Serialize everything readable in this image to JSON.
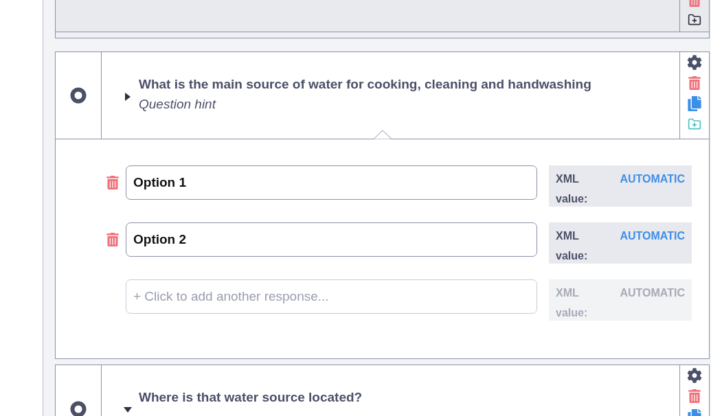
{
  "previous_question": {
    "actions": [
      {
        "kind": "delete"
      },
      {
        "kind": "add_to_group"
      }
    ]
  },
  "questions": [
    {
      "label": "What is the main source of water for cooking, cleaning and handwashing",
      "hint": "Question hint",
      "expanded": false,
      "actions": [
        {
          "kind": "settings"
        },
        {
          "kind": "delete"
        },
        {
          "kind": "duplicate"
        },
        {
          "kind": "add_group"
        }
      ],
      "options": [
        {
          "kind": "option",
          "value": "Option 1",
          "xml_label": "XML value:",
          "xml_value": "AUTOMATIC"
        },
        {
          "kind": "option",
          "value": "Option 2",
          "xml_label": "XML value:",
          "xml_value": "AUTOMATIC"
        },
        {
          "kind": "add",
          "placeholder": "+ Click to add another response...",
          "xml_label": "XML value:",
          "xml_value": "AUTOMATIC"
        }
      ]
    },
    {
      "label": "Where is that water source located?",
      "expanded": true,
      "actions": [
        {
          "kind": "settings"
        },
        {
          "kind": "delete"
        },
        {
          "kind": "duplicate"
        }
      ]
    }
  ]
}
